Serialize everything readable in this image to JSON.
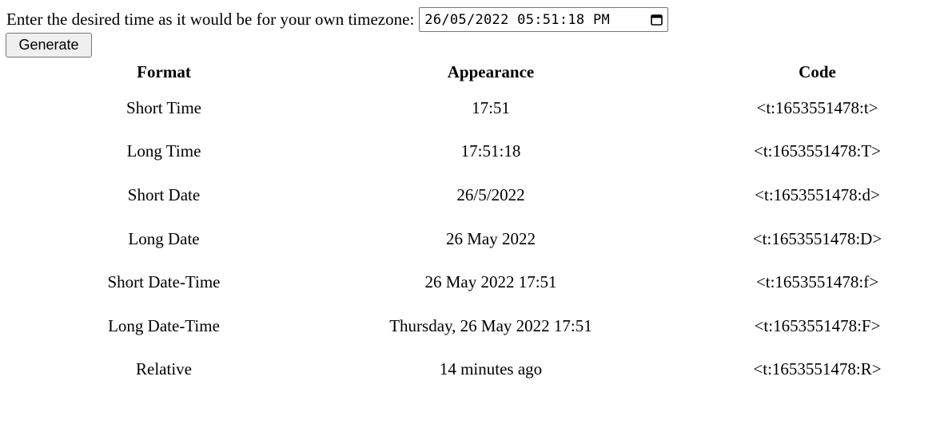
{
  "prompt": {
    "label": "Enter the desired time as it would be for your own timezone:",
    "datetime_value": "26/05/2022 05:51:18 PM",
    "calendar_icon": "calendar-icon"
  },
  "generate_button_label": "Generate",
  "table": {
    "headers": [
      "Format",
      "Appearance",
      "Code"
    ],
    "rows": [
      {
        "format": "Short Time",
        "appearance": "17:51",
        "code": "<t:1653551478:t>"
      },
      {
        "format": "Long Time",
        "appearance": "17:51:18",
        "code": "<t:1653551478:T>"
      },
      {
        "format": "Short Date",
        "appearance": "26/5/2022",
        "code": "<t:1653551478:d>"
      },
      {
        "format": "Long Date",
        "appearance": "26 May 2022",
        "code": "<t:1653551478:D>"
      },
      {
        "format": "Short Date-Time",
        "appearance": "26 May 2022 17:51",
        "code": "<t:1653551478:f>"
      },
      {
        "format": "Long Date-Time",
        "appearance": "Thursday, 26 May 2022 17:51",
        "code": "<t:1653551478:F>"
      },
      {
        "format": "Relative",
        "appearance": "14 minutes ago",
        "code": "<t:1653551478:R>"
      }
    ]
  }
}
